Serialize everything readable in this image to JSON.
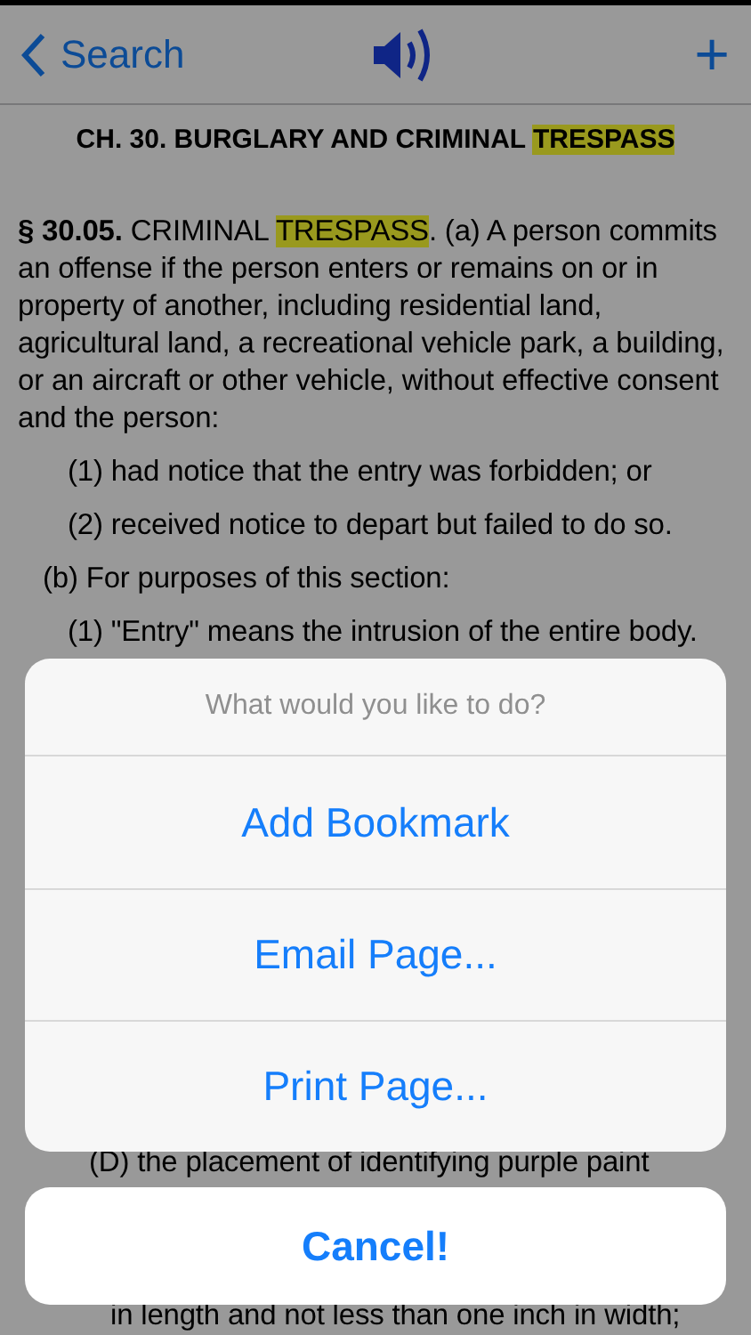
{
  "nav_bar": {
    "back_label": "Search",
    "add_symbol": "+"
  },
  "heading": [
    {
      "text": "CH. 30. BURGLARY AND CRIMINAL ",
      "highlighted": false
    },
    {
      "text": "TRESPASS",
      "highlighted": true
    }
  ],
  "paragraphs": [
    {
      "kind": "section",
      "segments": [
        {
          "text": "**§ 30.05.** CRIMINAL ",
          "highlighted": false
        },
        {
          "text": "TRESPASS",
          "highlighted": true
        },
        {
          "text": ". (a) A person commits an offense if the person enters or remains on or in property of another, including residential land, agricultural land, a recreational vehicle park, a building, or an aircraft or other vehicle, without effective consent and the person:",
          "highlighted": false
        }
      ]
    },
    {
      "kind": "item",
      "segments": [
        {
          "text": "(1) had notice that the entry was forbidden; or",
          "highlighted": false
        }
      ]
    },
    {
      "kind": "item",
      "segments": [
        {
          "text": "(2) received notice to depart but failed to do so.",
          "highlighted": false
        }
      ]
    },
    {
      "kind": "subsection",
      "segments": [
        {
          "text": "(b) For purposes of this section:",
          "highlighted": false
        }
      ]
    },
    {
      "kind": "item",
      "segments": [
        {
          "text": "(1) \"Entry\" means the intrusion of the entire body.",
          "highlighted": false
        }
      ]
    }
  ],
  "lower_lines": [
    {
      "kind": "subitem",
      "text": "(D) the placement of identifying purple paint"
    },
    {
      "kind": "continuation",
      "text": "in length and not less than one inch in width;"
    }
  ],
  "action_sheet": {
    "title": "What would you like to do?",
    "actions": [
      "Add Bookmark",
      "Email Page...",
      "Print Page..."
    ],
    "cancel": "Cancel!"
  }
}
